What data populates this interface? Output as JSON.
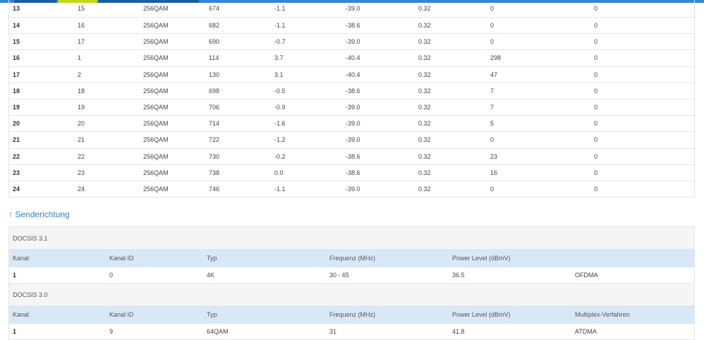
{
  "downstream_rows": [
    [
      "13",
      "15",
      "256QAM",
      "674",
      "-1.1",
      "-39.0",
      "0.32",
      "0",
      "0"
    ],
    [
      "14",
      "16",
      "256QAM",
      "682",
      "-1.1",
      "-38.6",
      "0.32",
      "0",
      "0"
    ],
    [
      "15",
      "17",
      "256QAM",
      "690",
      "-0.7",
      "-39.0",
      "0.32",
      "0",
      "0"
    ],
    [
      "16",
      "1",
      "256QAM",
      "114",
      "3.7",
      "-40.4",
      "0.32",
      "298",
      "0"
    ],
    [
      "17",
      "2",
      "256QAM",
      "130",
      "3.1",
      "-40.4",
      "0.32",
      "47",
      "0"
    ],
    [
      "18",
      "18",
      "256QAM",
      "698",
      "-0.5",
      "-38.6",
      "0.32",
      "7",
      "0"
    ],
    [
      "19",
      "19",
      "256QAM",
      "706",
      "-0.9",
      "-39.0",
      "0.32",
      "7",
      "0"
    ],
    [
      "20",
      "20",
      "256QAM",
      "714",
      "-1.6",
      "-39.0",
      "0.32",
      "5",
      "0"
    ],
    [
      "21",
      "21",
      "256QAM",
      "722",
      "-1.2",
      "-39.0",
      "0.32",
      "0",
      "0"
    ],
    [
      "22",
      "22",
      "256QAM",
      "730",
      "-0.2",
      "-38.6",
      "0.32",
      "23",
      "0"
    ],
    [
      "23",
      "23",
      "256QAM",
      "738",
      "0.0",
      "-38.6",
      "0.32",
      "16",
      "0"
    ],
    [
      "24",
      "24",
      "256QAM",
      "746",
      "-1.1",
      "-39.0",
      "0.32",
      "0",
      "0"
    ]
  ],
  "upstream": {
    "arrow": "↑",
    "title": "Senderichtung",
    "groups": [
      {
        "label": "DOCSIS 3.1",
        "headers": [
          "Kanal",
          "Kanal ID",
          "Typ",
          "Frequenz (MHz)",
          "Power Level (dBmV)",
          ""
        ],
        "rows": [
          [
            "1",
            "0",
            "4K",
            "30 - 65",
            "36.5",
            "OFDMA"
          ]
        ]
      },
      {
        "label": "DOCSIS 3.0",
        "headers": [
          "Kanal",
          "Kanal ID",
          "Typ",
          "Frequenz (MHz)",
          "Power Level (dBmV)",
          "Multiplex-Verfahren"
        ],
        "rows": [
          [
            "1",
            "9",
            "64QAM",
            "31",
            "41.8",
            "ATDMA"
          ]
        ]
      }
    ]
  }
}
